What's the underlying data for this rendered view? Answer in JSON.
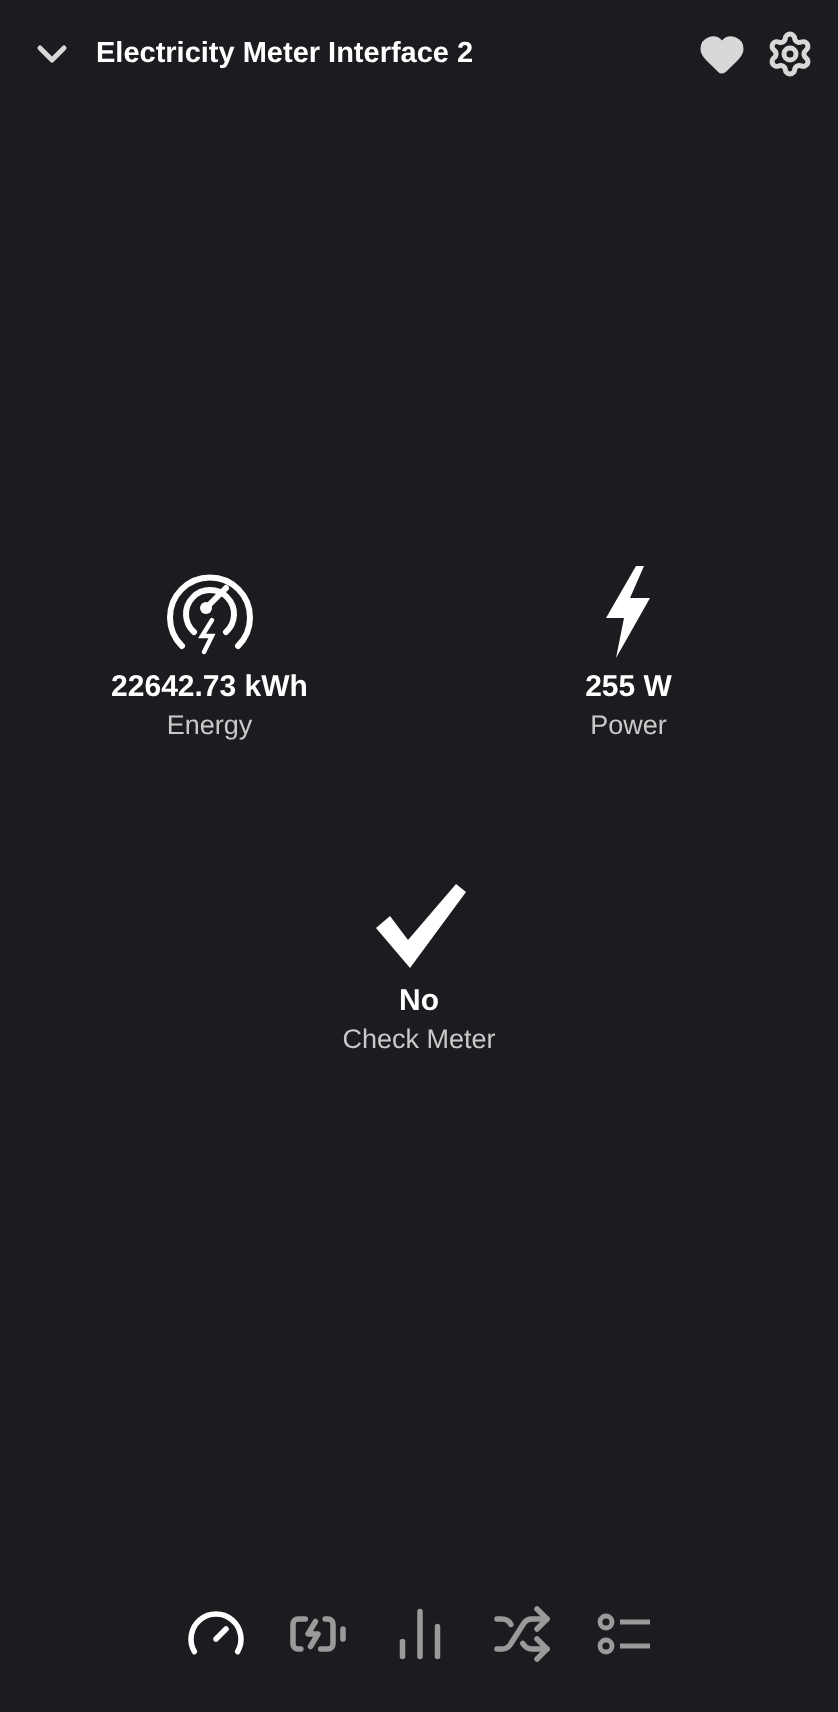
{
  "header": {
    "title": "Electricity Meter Interface 2",
    "favorite": true
  },
  "sensors": [
    {
      "kind": "energy",
      "value": "22642.73 kWh",
      "label": "Energy"
    },
    {
      "kind": "power",
      "value": "255 W",
      "label": "Power"
    },
    {
      "kind": "check",
      "value": "No",
      "label": "Check Meter"
    }
  ],
  "nav": [
    {
      "kind": "gauge",
      "selected": true
    },
    {
      "kind": "battery",
      "selected": false
    },
    {
      "kind": "bars",
      "selected": false
    },
    {
      "kind": "shuffle",
      "selected": false
    },
    {
      "kind": "list",
      "selected": false
    }
  ]
}
